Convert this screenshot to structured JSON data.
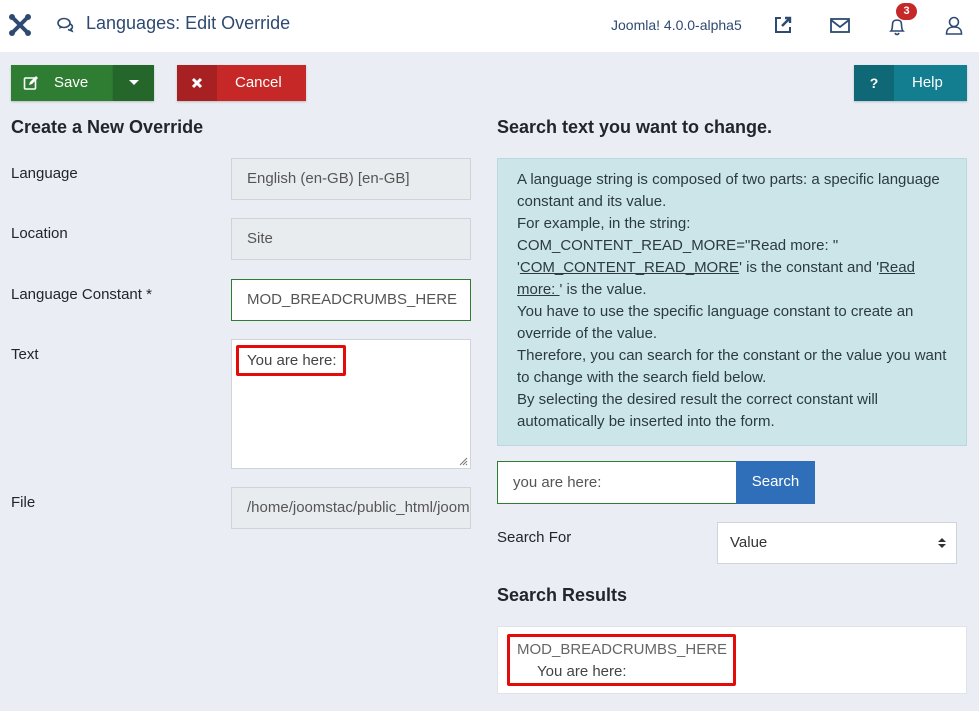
{
  "header": {
    "title": "Languages: Edit Override",
    "version": "Joomla! 4.0.0-alpha5",
    "notification_count": "3",
    "icons": [
      "joomla-logo-icon",
      "comments-icon",
      "external-link-icon",
      "mail-icon",
      "bell-icon",
      "user-icon"
    ]
  },
  "toolbar": {
    "save_label": "Save",
    "cancel_label": "Cancel",
    "help_label": "Help",
    "help_icon_glyph": "?"
  },
  "form": {
    "heading": "Create a New Override",
    "language_label": "Language",
    "language_value": "English (en-GB) [en-GB]",
    "location_label": "Location",
    "location_value": "Site",
    "constant_label": "Language Constant *",
    "constant_value": "MOD_BREADCRUMBS_HERE",
    "text_label": "Text",
    "text_value": "You are here:",
    "file_label": "File",
    "file_value": "/home/joomstac/public_html/joomla"
  },
  "search": {
    "heading": "Search text you want to change.",
    "info": {
      "line1": "A language string is composed of two parts: a specific language constant and its value.",
      "line2": "For example, in the string:",
      "line3": "COM_CONTENT_READ_MORE=\"Read more: \"",
      "line4_q1": "'",
      "line4_const": "COM_CONTENT_READ_MORE",
      "line4_mid": "' is the constant and '",
      "line4_val": "Read more: ",
      "line4_end": "' is the value.",
      "line5": "You have to use the specific language constant to create an override of the value.",
      "line6": "Therefore, you can search for the constant or the value you want to change with the search field below.",
      "line7": "By selecting the desired result the correct constant will automatically be inserted into the form."
    },
    "input_value": "you are here:",
    "button_label": "Search",
    "search_for_label": "Search For",
    "search_for_value": "Value",
    "results_heading": "Search Results",
    "results": [
      {
        "constant": "MOD_BREADCRUMBS_HERE",
        "value": "You are here:"
      }
    ]
  },
  "colors": {
    "save": "#2f7d32",
    "cancel": "#c52827",
    "help": "#127e8f",
    "search": "#2f6fba",
    "highlight": "#e40b0b",
    "info_bg": "#cce5e8"
  }
}
